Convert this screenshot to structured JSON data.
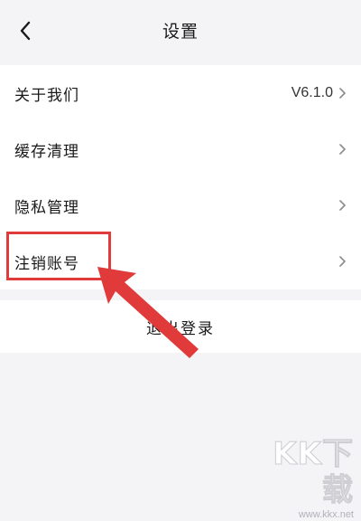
{
  "header": {
    "title": "设置",
    "back_icon": "chevron-left-icon"
  },
  "menu": {
    "items": [
      {
        "label": "关于我们",
        "value": "V6.1.0"
      },
      {
        "label": "缓存清理",
        "value": ""
      },
      {
        "label": "隐私管理",
        "value": ""
      },
      {
        "label": "注销账号",
        "value": ""
      }
    ]
  },
  "logout": {
    "label": "退出登录"
  },
  "annotation": {
    "highlight_color": "#e03a3a"
  },
  "watermark": {
    "brand": "KK下载",
    "url": "www.kkx.net"
  }
}
